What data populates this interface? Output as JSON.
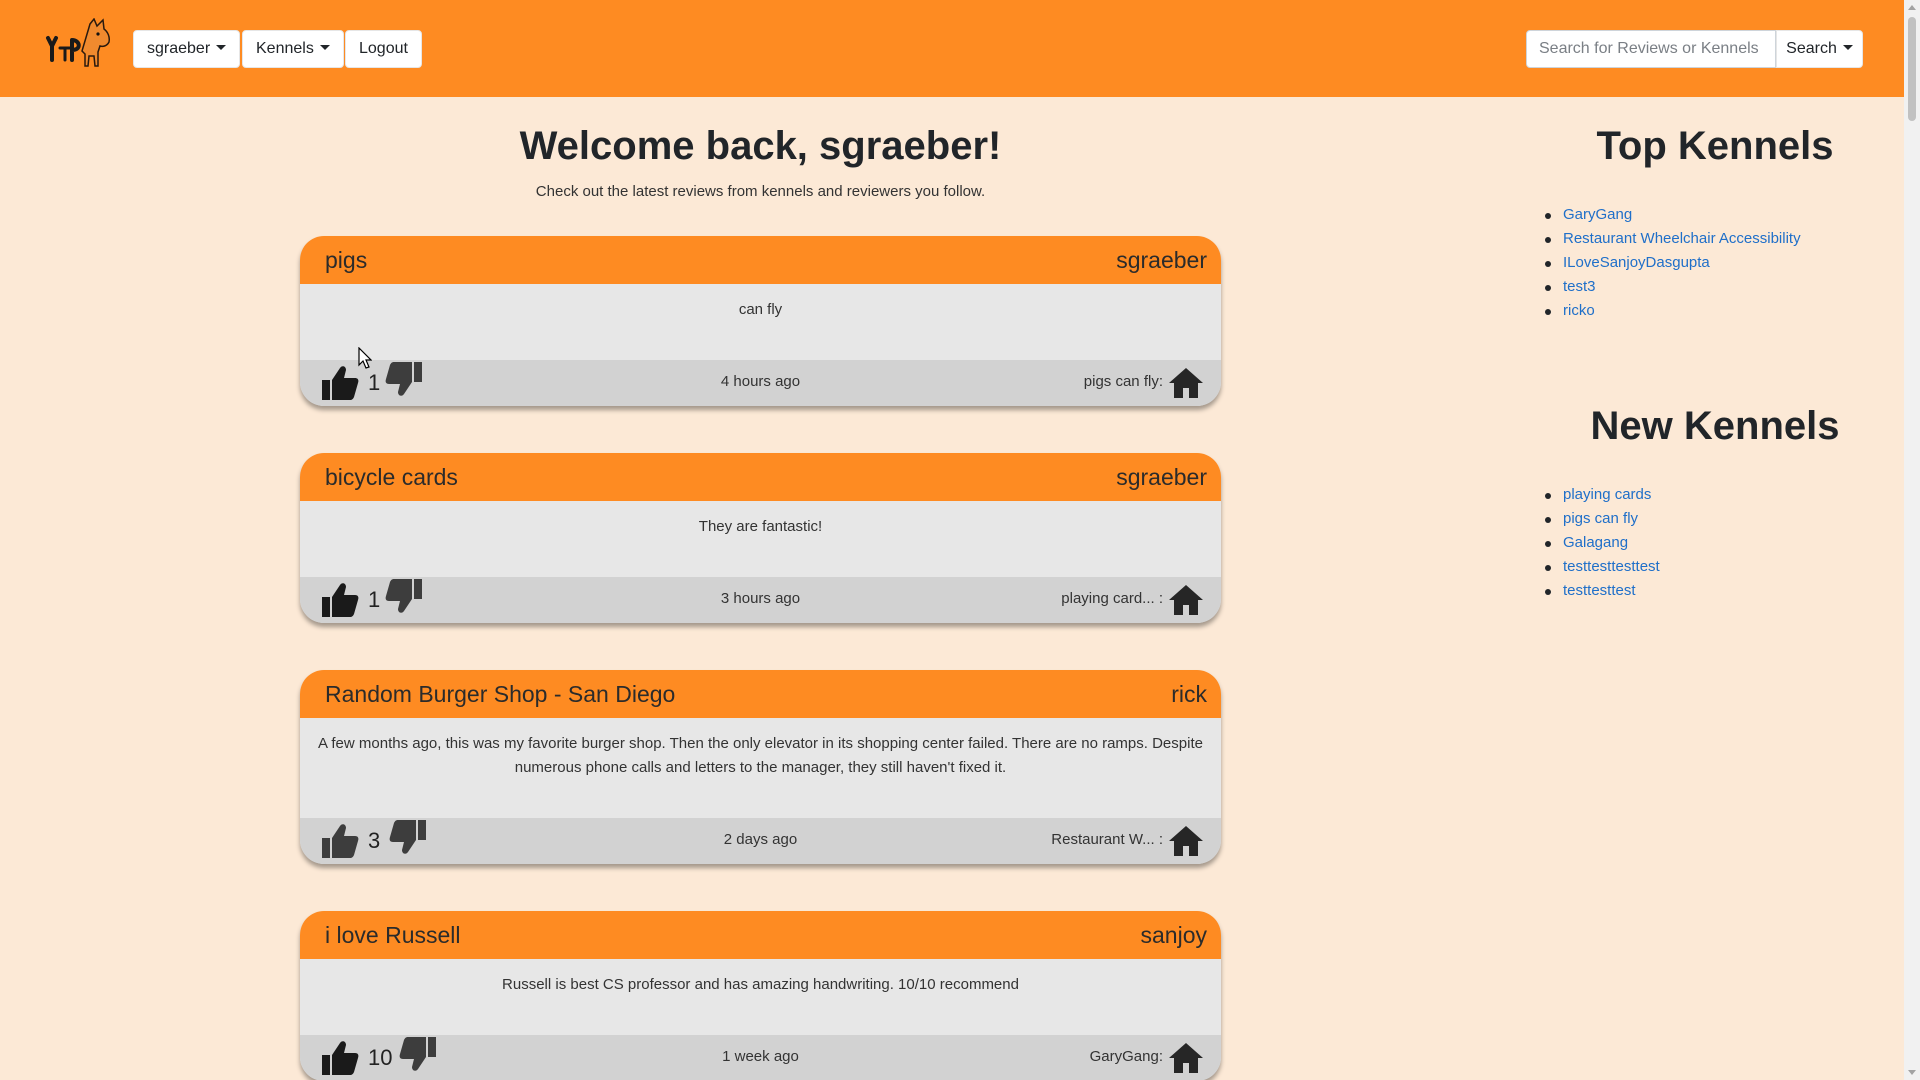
{
  "navbar": {
    "logo_name": "yelp-dog-logo",
    "user_menu": "sgraeber",
    "kennels_menu": "Kennels",
    "logout": "Logout",
    "search_placeholder": "Search for Reviews or Kennels",
    "search_button": "Search",
    "color": "#fe8b22"
  },
  "main": {
    "welcome": "Welcome back, sgraeber!",
    "subtitle": "Check out the latest reviews from kennels and reviewers you follow.",
    "reviews": [
      {
        "title": "pigs",
        "author": "sgraeber",
        "body": "can fly",
        "likes": "1",
        "time": "4 hours ago",
        "kennel": "pigs can fly:"
      },
      {
        "title": "bicycle cards",
        "author": "sgraeber",
        "body": "They are fantastic!",
        "likes": "1",
        "time": "3 hours ago",
        "kennel": "playing card... :"
      },
      {
        "title": "Random Burger Shop - San Diego",
        "author": "rick",
        "body": "A few months ago, this was my favorite burger shop. Then the only elevator in its shopping center failed. There are no ramps. Despite numerous phone calls and letters to the manager, they still haven't fixed it.",
        "likes": "3",
        "time": "2 days ago",
        "kennel": "Restaurant W... :"
      },
      {
        "title": "i love Russell",
        "author": "sanjoy",
        "body": "Russell is best CS professor and has amazing handwriting. 10/10 recommend",
        "likes": "10",
        "time": "1 week ago",
        "kennel": "GaryGang:"
      }
    ]
  },
  "sidebar": {
    "top_title": "Top Kennels",
    "top_kennels": [
      "GaryGang",
      "Restaurant Wheelchair Accessibility",
      "ILoveSanjoyDasgupta",
      "test3",
      "ricko"
    ],
    "new_title": "New Kennels",
    "new_kennels": [
      "playing cards",
      "pigs can fly",
      "Galagang",
      "testtesttesttest",
      "testtesttest"
    ]
  },
  "icons": {
    "like": "thumbs-up-icon",
    "dislike": "thumbs-down-icon",
    "kennel": "home-icon"
  }
}
